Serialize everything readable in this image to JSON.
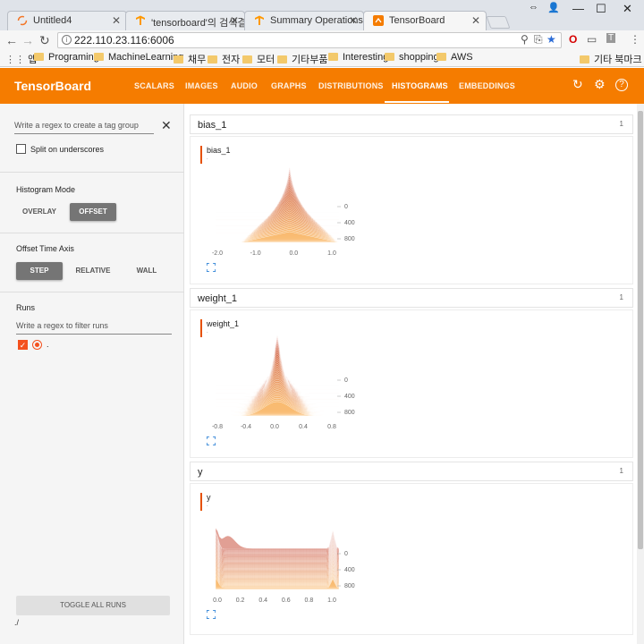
{
  "browser": {
    "tabs": [
      {
        "title": "Untitled4",
        "favicon": "jupyter-icon"
      },
      {
        "title": "'tensorboard'의 검색결과",
        "favicon": "tensorflow-icon"
      },
      {
        "title": "Summary Operations | Te",
        "favicon": "tensorflow-icon"
      },
      {
        "title": "TensorBoard",
        "favicon": "tensorboard-icon"
      }
    ],
    "address": "222.110.23.116:6006",
    "bookmarks": {
      "apps": "앱",
      "items": [
        "Programing",
        "MachineLearning",
        "채무",
        "전자",
        "모터",
        "기타부품",
        "Interesting",
        "shopping",
        "AWS"
      ],
      "other": "기타 북마크"
    }
  },
  "toolbar": {
    "brand": "TensorBoard",
    "tabs": [
      "SCALARS",
      "IMAGES",
      "AUDIO",
      "GRAPHS",
      "DISTRIBUTIONS",
      "HISTOGRAMS",
      "EMBEDDINGS"
    ],
    "active_tab": "HISTOGRAMS",
    "accent": "#f57c00"
  },
  "sidebar": {
    "tag_regex_placeholder": "Write a regex to create a tag group",
    "split_label": "Split on underscores",
    "histogram_mode": {
      "title": "Histogram Mode",
      "options": [
        "OVERLAY",
        "OFFSET"
      ],
      "selected": "OFFSET"
    },
    "offset_axis": {
      "title": "Offset Time Axis",
      "options": [
        "STEP",
        "RELATIVE",
        "WALL"
      ],
      "selected": "STEP"
    },
    "runs": {
      "title": "Runs",
      "filter_placeholder": "Write a regex to filter runs",
      "items": [
        {
          "name": ".",
          "checked": true,
          "color": "#f4511e"
        }
      ]
    },
    "toggle_label": "TOGGLE ALL RUNS",
    "logdir": "./"
  },
  "categories": [
    {
      "name": "bias_1",
      "count": "1",
      "tag": "bias_1",
      "run": ".",
      "x_ticks": [
        "-2.0",
        "-1.0",
        "0.0",
        "1.0"
      ],
      "y_ticks": [
        "0",
        "400",
        "800"
      ],
      "shape": "pyramid"
    },
    {
      "name": "weight_1",
      "count": "1",
      "tag": "weight_1",
      "run": ".",
      "x_ticks": [
        "-0.8",
        "-0.4",
        "0.0",
        "0.4",
        "0.8"
      ],
      "y_ticks": [
        "0",
        "400",
        "800"
      ],
      "shape": "spike"
    },
    {
      "name": "y",
      "count": "1",
      "tag": "y",
      "run": ".",
      "x_ticks": [
        "0.0",
        "0.2",
        "0.4",
        "0.6",
        "0.8",
        "1.0"
      ],
      "y_ticks": [
        "0",
        "400",
        "800"
      ],
      "shape": "edges"
    }
  ]
}
